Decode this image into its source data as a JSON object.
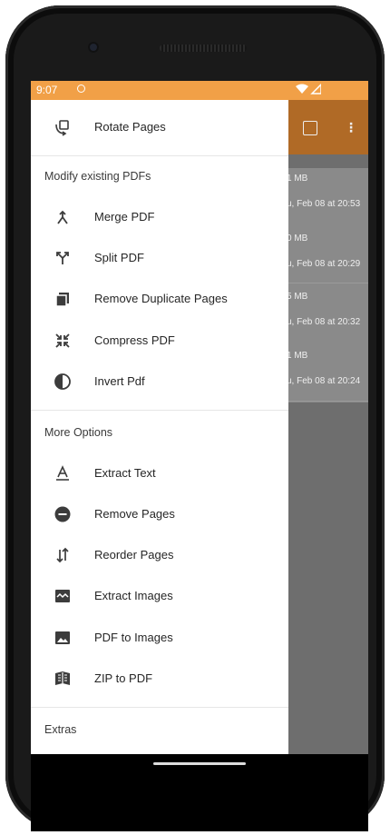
{
  "status": {
    "time": "9:07"
  },
  "background_app": {
    "files": [
      {
        "size": "1 MB",
        "date": "u, Feb 08 at 20:53"
      },
      {
        "size": "0 MB",
        "date": "u, Feb 08 at 20:29"
      },
      {
        "size": "5 MB",
        "date": "u, Feb 08 at 20:32"
      },
      {
        "size": "1 MB",
        "date": "u, Feb 08 at 20:24"
      }
    ]
  },
  "drawer": {
    "top_item": {
      "label": "Rotate Pages",
      "icon": "rotate-icon"
    },
    "sections": [
      {
        "title": "Modify existing PDFs",
        "items": [
          {
            "label": "Merge PDF",
            "icon": "merge-icon"
          },
          {
            "label": "Split PDF",
            "icon": "split-icon"
          },
          {
            "label": "Remove Duplicate Pages",
            "icon": "duplicate-icon"
          },
          {
            "label": "Compress PDF",
            "icon": "compress-icon"
          },
          {
            "label": "Invert Pdf",
            "icon": "invert-icon"
          }
        ]
      },
      {
        "title": "More Options",
        "items": [
          {
            "label": "Extract Text",
            "icon": "text-icon"
          },
          {
            "label": "Remove Pages",
            "icon": "remove-icon"
          },
          {
            "label": "Reorder Pages",
            "icon": "reorder-icon"
          },
          {
            "label": "Extract Images",
            "icon": "image-extract-icon"
          },
          {
            "label": "PDF to Images",
            "icon": "image-icon"
          },
          {
            "label": "ZIP to PDF",
            "icon": "zip-icon"
          }
        ]
      }
    ],
    "extras_title": "Extras"
  }
}
